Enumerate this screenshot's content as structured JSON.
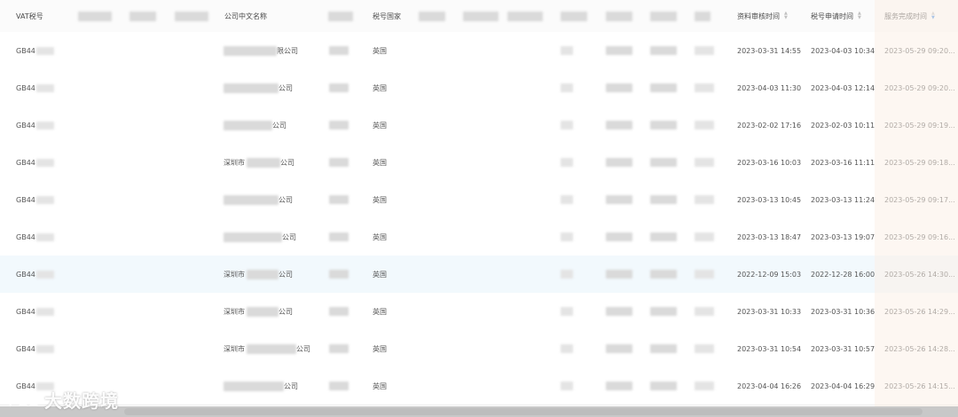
{
  "headers": {
    "vat_no": "VAT税号",
    "company_cn": "公司中文名称",
    "tax_country": "税号国家",
    "review_time": "资料审核时间",
    "apply_time": "税号申请时间",
    "complete_time": "服务完成时间"
  },
  "rows": [
    {
      "vat_prefix": "GB44",
      "company_prefix": "",
      "company_suffix": "限公司",
      "country": "英国",
      "review_time": "2023-03-31 14:55",
      "apply_time": "2023-04-03 10:34",
      "complete_time": "2023-05-29 09:20..."
    },
    {
      "vat_prefix": "GB44",
      "company_prefix": "",
      "company_suffix": "公司",
      "country": "英国",
      "review_time": "2023-04-03 11:30",
      "apply_time": "2023-04-03 12:14",
      "complete_time": "2023-05-29 09:20..."
    },
    {
      "vat_prefix": "GB44",
      "company_prefix": "",
      "company_suffix": "公司",
      "country": "英国",
      "review_time": "2023-02-02 17:16",
      "apply_time": "2023-02-03 10:11",
      "complete_time": "2023-05-29 09:19..."
    },
    {
      "vat_prefix": "GB44",
      "company_prefix": "深圳市",
      "company_suffix": "公司",
      "country": "英国",
      "review_time": "2023-03-16 10:03",
      "apply_time": "2023-03-16 11:11",
      "complete_time": "2023-05-29 09:18..."
    },
    {
      "vat_prefix": "GB44",
      "company_prefix": "",
      "company_suffix": "公司",
      "country": "英国",
      "review_time": "2023-03-13 10:45",
      "apply_time": "2023-03-13 11:24",
      "complete_time": "2023-05-29 09:17..."
    },
    {
      "vat_prefix": "GB44",
      "company_prefix": "",
      "company_suffix": "公司",
      "country": "英国",
      "review_time": "2023-03-13 18:47",
      "apply_time": "2023-03-13 19:07",
      "complete_time": "2023-05-29 09:16..."
    },
    {
      "vat_prefix": "GB44",
      "company_prefix": "深圳市",
      "company_suffix": "公司",
      "country": "英国",
      "review_time": "2022-12-09 15:03",
      "apply_time": "2022-12-28 16:00",
      "complete_time": "2023-05-26 14:30..."
    },
    {
      "vat_prefix": "GB44",
      "company_prefix": "深圳市",
      "company_suffix": "公司",
      "country": "英国",
      "review_time": "2023-03-31 10:33",
      "apply_time": "2023-03-31 10:36",
      "complete_time": "2023-05-26 14:29..."
    },
    {
      "vat_prefix": "GB44",
      "company_prefix": "深圳市",
      "company_suffix": "公司",
      "country": "英国",
      "review_time": "2023-03-31 10:54",
      "apply_time": "2023-03-31 10:57",
      "complete_time": "2023-05-26 14:28..."
    },
    {
      "vat_prefix": "GB44",
      "company_prefix": "",
      "company_suffix": "公司",
      "country": "英国",
      "review_time": "2023-04-04 16:26",
      "apply_time": "2023-04-04 16:29",
      "complete_time": "2023-05-26 14:15..."
    }
  ],
  "watermark": {
    "text": "大数跨境"
  },
  "colors": {
    "accent": "#4a90e2",
    "highlight_row": "#f2f9fd",
    "sorted_column": "#fcf0e8"
  }
}
